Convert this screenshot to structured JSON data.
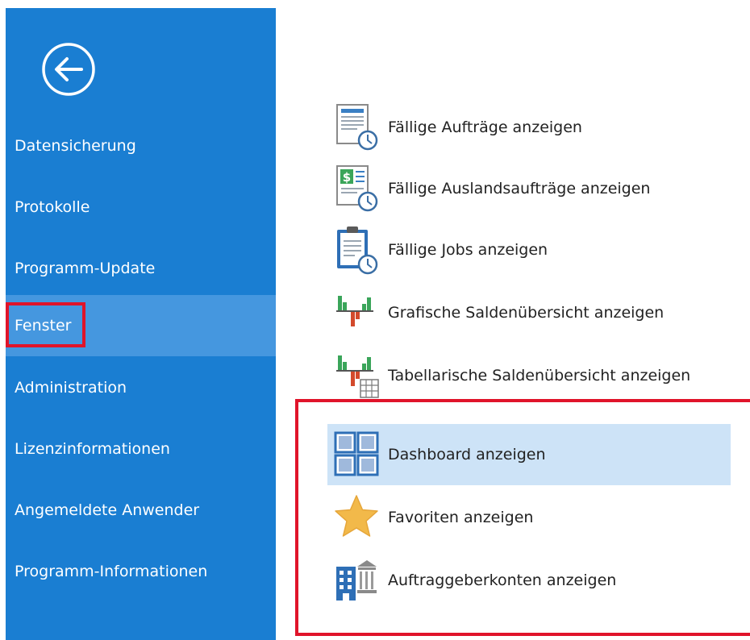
{
  "sidebar": {
    "back_icon": "back-arrow-icon",
    "items": [
      {
        "label": "Datensicherung"
      },
      {
        "label": "Protokolle"
      },
      {
        "label": "Programm-Update"
      },
      {
        "label": "Fenster"
      },
      {
        "label": "Administration"
      },
      {
        "label": "Lizenzinformationen"
      },
      {
        "label": "Angemeldete Anwender"
      },
      {
        "label": "Programm-Informationen"
      }
    ],
    "active_item": "Fenster"
  },
  "main": {
    "items": [
      {
        "label": "Fällige Aufträge anzeigen",
        "icon": "due-orders-icon"
      },
      {
        "label": "Fällige Auslandsaufträge anzeigen",
        "icon": "due-foreign-orders-icon"
      },
      {
        "label": "Fällige Jobs anzeigen",
        "icon": "due-jobs-icon"
      },
      {
        "label": "Grafische Saldenübersicht anzeigen",
        "icon": "graphic-balance-chart-icon"
      },
      {
        "label": "Tabellarische Saldenübersicht anzeigen",
        "icon": "table-balance-chart-icon"
      },
      {
        "label": "Dashboard anzeigen",
        "icon": "dashboard-grid-icon"
      },
      {
        "label": "Favoriten anzeigen",
        "icon": "star-icon"
      },
      {
        "label": "Auftraggeberkonten anzeigen",
        "icon": "bank-building-icon"
      }
    ],
    "highlighted_item": "Dashboard anzeigen"
  },
  "colors": {
    "sidebar_bg": "#1a7ed2",
    "sidebar_active": "#4597df",
    "highlight_bg": "#cde3f7",
    "annotation_red": "#e0142a"
  }
}
